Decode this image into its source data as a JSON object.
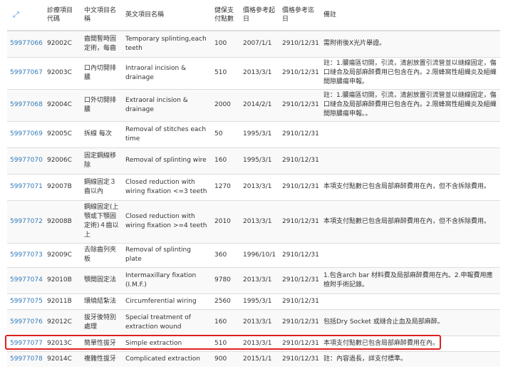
{
  "table": {
    "headers": {
      "expand_icon": "⤢",
      "code": "診療項目代碼",
      "zh_name": "中文項目名稱",
      "en_name": "英文項目名稱",
      "points": "健保支付點數",
      "start": "價格參考起日",
      "end": "價格參考迄日",
      "note": "備註"
    },
    "rows": [
      {
        "id": "59977066",
        "code": "92002C",
        "zh": "齒間暫時固定術，每齒",
        "en": "Temporary splinting,each teeth",
        "points": "100",
        "start": "2007/1/1",
        "end": "2910/12/31",
        "note": "需附術後X光片舉證。"
      },
      {
        "id": "59977067",
        "code": "92003C",
        "zh": "口內切開排膿",
        "en": "Intraoral incision & drainage",
        "points": "510",
        "start": "2013/3/1",
        "end": "2910/12/31",
        "note": "註：1.膿瘍區切開，引流，清創放置引流管並以縫線固定，傷口縫合及局部麻醉費用已包含在內。2.限蜂窩性組織炎及組織間隙膿瘍申報。"
      },
      {
        "id": "59977068",
        "code": "92004C",
        "zh": "口外切開排膿",
        "en": "Extraoral incision & drainage",
        "points": "2000",
        "start": "2014/2/1",
        "end": "2910/12/31",
        "note": "註：1.膿瘍區切開，引流，清創放置引流管並以縫線固定，傷口縫合及局部麻醉費用已包含在內。2.限蜂窩性組織炎及組織間隙膿瘍申報。。"
      },
      {
        "id": "59977069",
        "code": "92005C",
        "zh": "拆線 每次",
        "en": "Removal of stitches each time",
        "points": "50",
        "start": "1995/3/1",
        "end": "2910/12/31",
        "note": ""
      },
      {
        "id": "59977070",
        "code": "92006C",
        "zh": "固定鋼線移除",
        "en": "Removal of splinting wire",
        "points": "160",
        "start": "1995/3/1",
        "end": "2910/12/31",
        "note": ""
      },
      {
        "id": "59977071",
        "code": "92007B",
        "zh": "鋼線固定３齒以內",
        "en": "Closed reduction with wiring fixation <=3 teeth",
        "points": "1270",
        "start": "2013/3/1",
        "end": "2910/12/31",
        "note": "本項支付點數已包含局部麻醉費用在內，但不含拆除費用。"
      },
      {
        "id": "59977072",
        "code": "92008B",
        "zh": "鋼線固定(上顎或下顎固定術)４齒以上",
        "en": "Closed reduction with wiring fixation >=4 teeth",
        "points": "2010",
        "start": "2013/3/1",
        "end": "2910/12/31",
        "note": "本項支付點數已包含局部麻醉費用在內，但不含拆除費用。"
      },
      {
        "id": "59977073",
        "code": "92009C",
        "zh": "去除齒列夾板",
        "en": "Removal of splinting plate",
        "points": "360",
        "start": "1996/10/1",
        "end": "2910/12/31",
        "note": ""
      },
      {
        "id": "59977074",
        "code": "92010B",
        "zh": "顎間固定法",
        "en": "Intermaxillary fixation (I.M.F.)",
        "points": "9780",
        "start": "2013/3/1",
        "end": "2910/12/31",
        "note": "1.包含arch bar 材料費及局部麻醉費用在內。2.申報費用應檢附手術記錄。"
      },
      {
        "id": "59977075",
        "code": "92011B",
        "zh": "環繞結紮法",
        "en": "Circumferential wiring",
        "points": "2560",
        "start": "1995/3/1",
        "end": "2910/12/31",
        "note": ""
      },
      {
        "id": "59977076",
        "code": "92012C",
        "zh": "拔牙後特別處理",
        "en": "Special treatment of extraction wound",
        "points": "160",
        "start": "2013/3/1",
        "end": "2910/12/31",
        "note": "包括Dry Socket 或縫合止血及局部麻醉。"
      },
      {
        "id": "59977077",
        "code": "92013C",
        "zh": "簡單性拔牙",
        "en": "Simple extraction",
        "points": "510",
        "start": "2013/3/1",
        "end": "2910/12/31",
        "note": "本項支付點數已包含局部麻醉費用在內。"
      },
      {
        "id": "59977078",
        "code": "92014C",
        "zh": "複雜性拔牙",
        "en": "Complicated extraction",
        "points": "900",
        "start": "2015/1/1",
        "end": "2910/12/31",
        "note": "註：內容過長，詳支付標準。"
      }
    ]
  }
}
